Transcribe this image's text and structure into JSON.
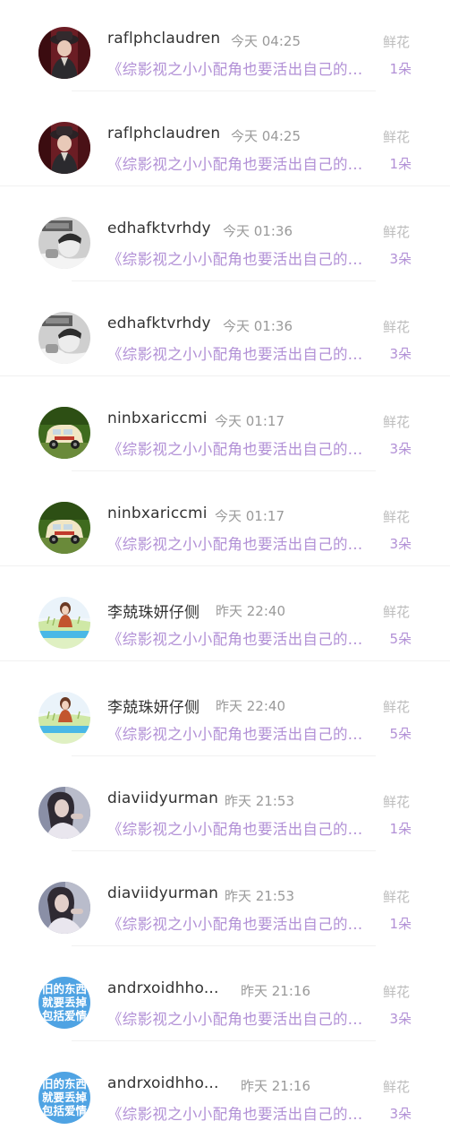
{
  "rows": [
    {
      "name": "raflphclaudren",
      "time": "今天 04:25",
      "type": "鲜花",
      "book": "《综影视之小小配角也要活出自己的...",
      "count": "1朵",
      "avatar": "avatar-man-hat"
    },
    {
      "name": "raflphclaudren",
      "time": "今天 04:25",
      "type": "鲜花",
      "book": "《综影视之小小配角也要活出自己的...",
      "count": "1朵",
      "avatar": "avatar-man-hat"
    },
    {
      "name": "edhafktvrhdy",
      "time": "今天 01:36",
      "type": "鲜花",
      "book": "《综影视之小小配角也要活出自己的...",
      "count": "3朵",
      "avatar": "avatar-bw-portrait"
    },
    {
      "name": "edhafktvrhdy",
      "time": "今天 01:36",
      "type": "鲜花",
      "book": "《综影视之小小配角也要活出自己的...",
      "count": "3朵",
      "avatar": "avatar-bw-portrait"
    },
    {
      "name": "ninbxariccmi",
      "time": "今天 01:17",
      "type": "鲜花",
      "book": "《综影视之小小配角也要活出自己的...",
      "count": "3朵",
      "avatar": "avatar-toy-car"
    },
    {
      "name": "ninbxariccmi",
      "time": "今天 01:17",
      "type": "鲜花",
      "book": "《综影视之小小配角也要活出自己的...",
      "count": "3朵",
      "avatar": "avatar-toy-car"
    },
    {
      "name": "李兢珠妍仔侧",
      "time": "昨天 22:40",
      "type": "鲜花",
      "book": "《综影视之小小配角也要活出自己的...",
      "count": "5朵",
      "avatar": "avatar-girl-meadow"
    },
    {
      "name": "李兢珠妍仔侧",
      "time": "昨天 22:40",
      "type": "鲜花",
      "book": "《综影视之小小配角也要活出自己的...",
      "count": "5朵",
      "avatar": "avatar-girl-meadow"
    },
    {
      "name": "diaviidyurman",
      "time": "昨天 21:53",
      "type": "鲜花",
      "book": "《综影视之小小配角也要活出自己的...",
      "count": "1朵",
      "avatar": "avatar-woman-soft"
    },
    {
      "name": "diaviidyurman",
      "time": "昨天 21:53",
      "type": "鲜花",
      "book": "《综影视之小小配角也要活出自己的...",
      "count": "1朵",
      "avatar": "avatar-woman-soft"
    },
    {
      "name": "andrxoidhho...",
      "time": "昨天 21:16",
      "type": "鲜花",
      "book": "《综影视之小小配角也要活出自己的...",
      "count": "3朵",
      "avatar": "avatar-text-blue",
      "avatar_text": [
        "旧的东西",
        "就要丢掉",
        "包括爱情"
      ]
    },
    {
      "name": "andrxoidhho...",
      "time": "昨天 21:16",
      "type": "鲜花",
      "book": "《综影视之小小配角也要活出自己的...",
      "count": "3朵",
      "avatar": "avatar-text-blue",
      "avatar_text": [
        "旧的东西",
        "就要丢掉",
        "包括爱情"
      ]
    }
  ]
}
